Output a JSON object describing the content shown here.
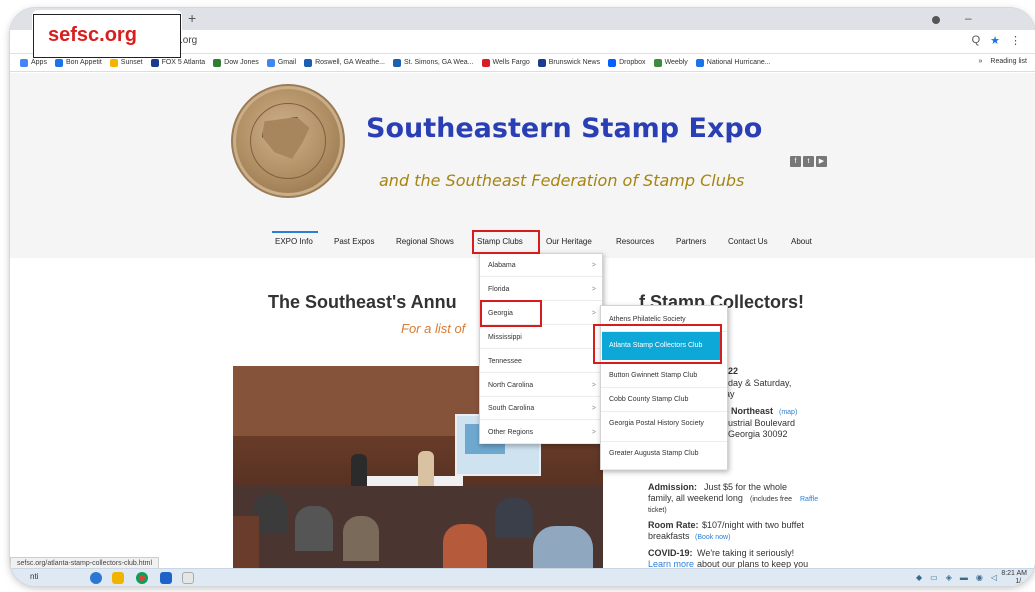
{
  "browser": {
    "new_tab_glyph": "+",
    "url_partial": ".org",
    "window_min_glyph": "–",
    "address_icons": [
      "Q",
      "★",
      "⋮"
    ],
    "bookmarks": [
      {
        "label": "Apps",
        "color": "#4285f4"
      },
      {
        "label": "Bon Appetit",
        "color": "#1a73e8"
      },
      {
        "label": "Sunset",
        "color": "#f4b400"
      },
      {
        "label": "FOX 5 Atlanta",
        "color": "#1a3c8f"
      },
      {
        "label": "Dow Jones",
        "color": "#2e7d32"
      },
      {
        "label": "Gmail",
        "color": "#4285f4"
      },
      {
        "label": "Roswell, GA Weathe...",
        "color": "#1a5fb4"
      },
      {
        "label": "St. Simons, GA Wea...",
        "color": "#1a5fb4"
      },
      {
        "label": "Wells Fargo",
        "color": "#d71e28"
      },
      {
        "label": "Brunswick News",
        "color": "#1a3c8f"
      },
      {
        "label": "Dropbox",
        "color": "#0061ff"
      },
      {
        "label": "Weebly",
        "color": "#3d8b3d"
      },
      {
        "label": "National Hurricane...",
        "color": "#1a73e8"
      }
    ],
    "bookmarks_overflow": "»",
    "reading_list": "Reading list",
    "status_url": "sefsc.org/atlanta-stamp-collectors-club.html"
  },
  "annotation": {
    "label": "sefsc.org"
  },
  "site": {
    "title": "Southeastern Stamp Expo",
    "subtitle": "and the Southeast Federation of Stamp Clubs",
    "social_icons": [
      "f",
      "t",
      "▶"
    ]
  },
  "nav": {
    "items": [
      "EXPO Info",
      "Past Expos",
      "Regional Shows",
      "Stamp Clubs",
      "Our Heritage",
      "Resources",
      "Partners",
      "Contact Us",
      "About"
    ]
  },
  "dropdown_states": {
    "items": [
      {
        "label": "Alabama",
        "arrow": ">"
      },
      {
        "label": "Florida",
        "arrow": ">"
      },
      {
        "label": "Georgia",
        "arrow": ">"
      },
      {
        "label": "Mississippi",
        "arrow": ""
      },
      {
        "label": "Tennessee",
        "arrow": ""
      },
      {
        "label": "North Carolina",
        "arrow": ">"
      },
      {
        "label": "South Carolina",
        "arrow": ">"
      },
      {
        "label": "Other Regions",
        "arrow": ">"
      }
    ]
  },
  "dropdown_georgia": {
    "items": [
      "Athens Philatelic Society",
      "Atlanta Stamp Collectors Club",
      "Button Gwinnett Stamp Club",
      "Cobb County Stamp Club",
      "Georgia Postal History Society",
      "Greater Augusta Stamp Club"
    ]
  },
  "main": {
    "heading_start": "The Southeast's Annu",
    "heading_end": "f Stamp Collectors!",
    "subline": "For a list of",
    "info": {
      "year_fragment": "022",
      "days_line1": "riday & Saturday,",
      "days_line2": "lay",
      "venue_fragment": "n Northeast",
      "map_link": "(map)",
      "street_fragment": "dustrial Boulevard",
      "city_fragment": ", Georgia 30092",
      "admission_label": "Admission:",
      "admission_text": "Just $5 for the whole",
      "admission_text2": "family, all weekend long",
      "admission_note": "(includes free",
      "raffle_link": "Raffle",
      "admission_note2": "ticket)",
      "room_label": "Room Rate:",
      "room_text": "$107/night with two buffet",
      "room_text2": "breakfasts",
      "book_link": "(Book now)",
      "covid_label": "COVID-19:",
      "covid_text": "We're taking it seriously!",
      "covid_link": "Learn more",
      "covid_text2": "about our plans to keep you"
    }
  },
  "taskbar": {
    "start_text": "nti",
    "clock_time": "8:21 AM",
    "clock_date": "1/..."
  },
  "colors": {
    "title_blue": "#2b3fb5",
    "subtitle_gold": "#a78410",
    "highlight_cyan": "#0ea8d8",
    "annotation_red": "#d81c1c"
  }
}
